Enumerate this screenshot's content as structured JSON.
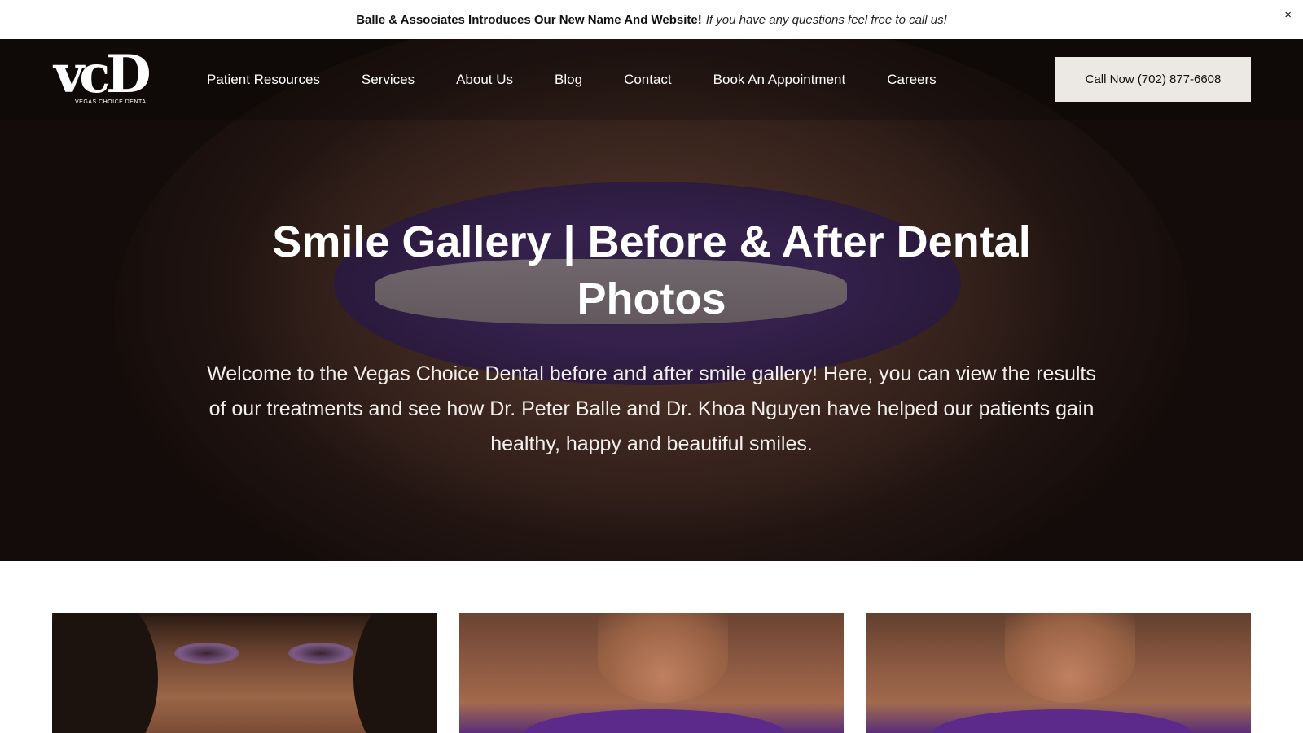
{
  "announcement": {
    "bold_text": "Balle & Associates Introduces Our New Name And Website!",
    "italic_text": "If you have any questions feel free to call us!",
    "close_label": "×"
  },
  "logo": {
    "mark": "vcD",
    "subtitle": "VEGAS CHOICE DENTAL"
  },
  "nav": {
    "items": [
      {
        "label": "Patient Resources"
      },
      {
        "label": "Services"
      },
      {
        "label": "About Us"
      },
      {
        "label": "Blog"
      },
      {
        "label": "Contact"
      },
      {
        "label": "Book An Appointment"
      },
      {
        "label": "Careers"
      }
    ],
    "cta_label": "Call Now (702) 877-6608"
  },
  "hero": {
    "title": "Smile Gallery | Before & After Dental Photos",
    "description": "Welcome to the Vegas Choice Dental before and after smile gallery! Here, you can view the results of our treatments and see how Dr. Peter Balle and Dr. Khoa Nguyen have helped our patients gain healthy, happy and beautiful smiles."
  },
  "colors": {
    "cta_background": "#ece9e4",
    "announcement_background": "#ffffff",
    "lipstick": "#5b2a8a"
  }
}
